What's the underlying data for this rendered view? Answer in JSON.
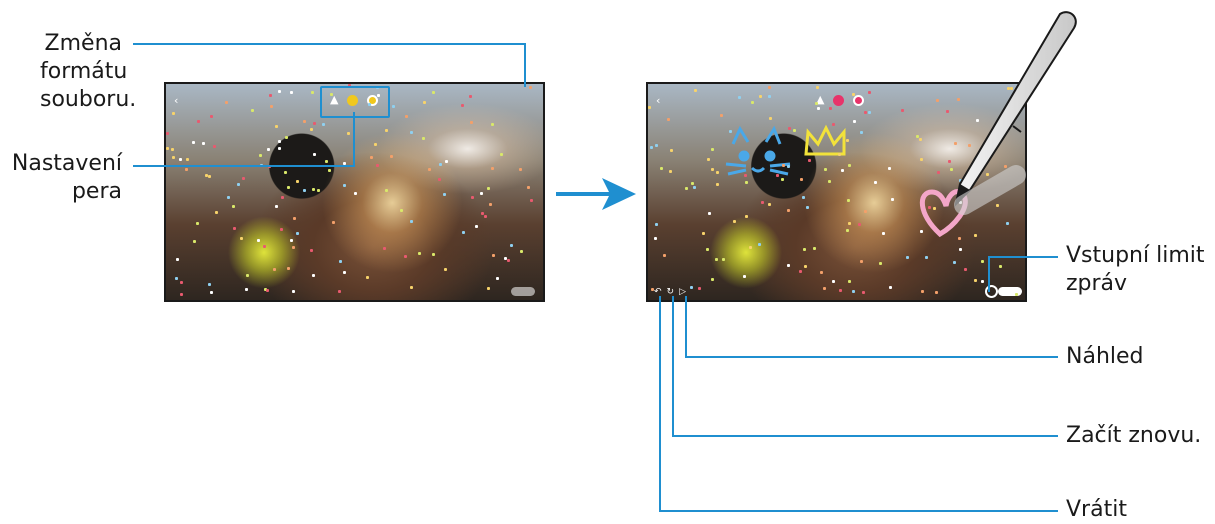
{
  "callouts": {
    "format_line1": "Změna",
    "format_line2": "formátu",
    "format_line3": "souboru.",
    "pen_line1": "Nastavení",
    "pen_line2": "pera",
    "limit_line1": "Vstupní limit",
    "limit_line2": "zpráv",
    "preview": "Náhled",
    "restart": "Začít znovu.",
    "undo": "Vrátit"
  },
  "colors": {
    "leader_line": "#1f8fd0",
    "pen_yellow": "#f0c81e",
    "pen_pink": "#e8336a",
    "drawing_blue": "#4aa8e8",
    "drawing_yellow": "#f2e23a",
    "drawing_pink": "#f3a6c8"
  },
  "icons": {
    "format": "flame-icon",
    "back": "chevron-left-icon",
    "arrow": "arrow-right-icon",
    "pen": "stylus-pen-icon"
  }
}
